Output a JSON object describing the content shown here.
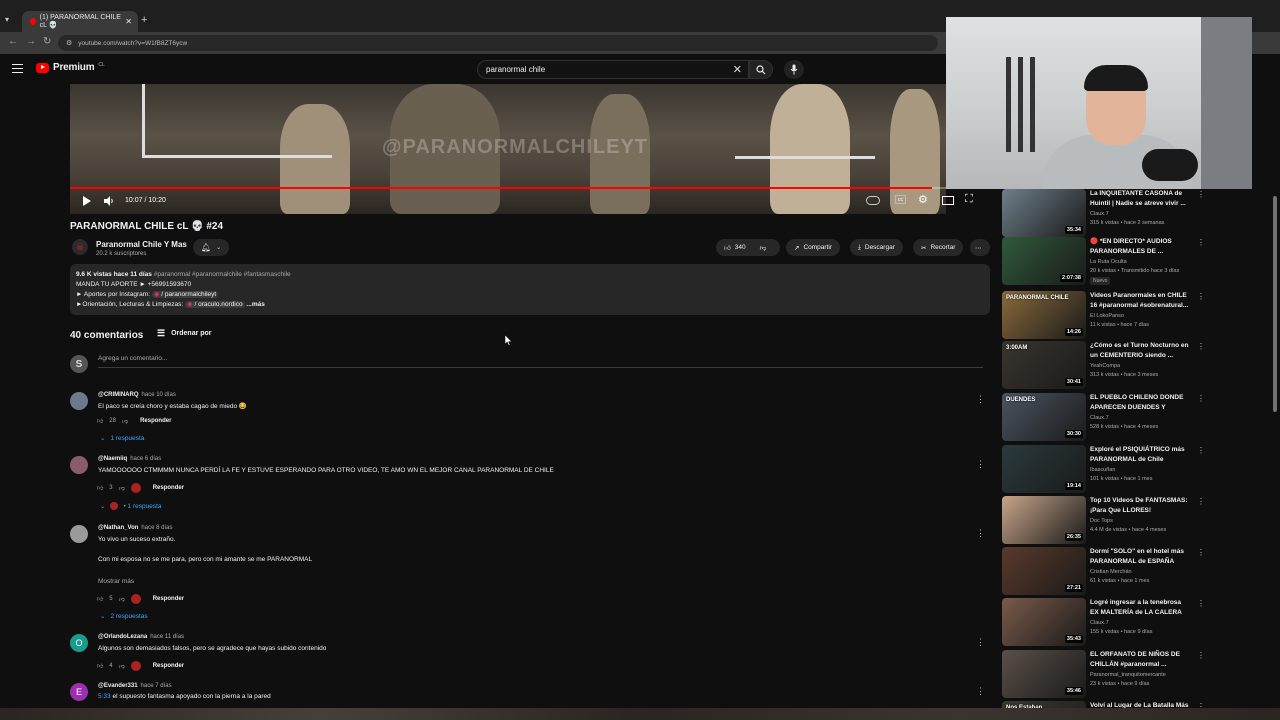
{
  "browser": {
    "tab_title": "(1) PARANORMAL CHILE cL 💀",
    "url": "youtube.com/watch?v=W1fB8ZT6ycw"
  },
  "header": {
    "logo_text": "Premium",
    "logo_region": "CL",
    "search_value": "paranormal chile"
  },
  "player": {
    "watermark": "@PARANORMALCHILEYT",
    "time": "10:07 / 10:20",
    "progress_fraction": 0.984
  },
  "video": {
    "title": "PARANORMAL CHILE cL 💀 #24",
    "channel": "Paranormal Chile Y Mas",
    "subscribers": "20.2 k suscriptores",
    "likes": "340",
    "share_label": "Compartir",
    "download_label": "Descargar",
    "clip_label": "Recortar"
  },
  "description": {
    "meta": "9.6 K vistas  hace 11 días",
    "tags": "#paranormal #paranormalchile #fantasmaschile",
    "line1": "MANDA TU APORTE ► +56991593670",
    "line2_prefix": "► Aportes por Instagram:",
    "line2_link": "/ paranormalchileyt",
    "line3_prefix": "►Orientación, Lecturas & Limpiezas:",
    "line3_link": "/ oraculo.nordico",
    "more": "...más"
  },
  "comments": {
    "count": "40 comentarios",
    "sort_label": "Ordenar por",
    "add_placeholder": "Agrega un comentario...",
    "my_avatar": "S",
    "reply_label": "Responder",
    "items": [
      {
        "handle": "@CRIMINARQ",
        "ago": "hace 10 días",
        "text": "El paco se creía choro y estaba cagao de miedo 😂",
        "likes": "28",
        "replies": "1 respuesta",
        "color": "#6b7b8c",
        "initial": ""
      },
      {
        "handle": "@Naemiiq",
        "ago": "hace 6 días",
        "text": "YAMOOOOOO CTMMMM NUNCA PERDÍ LA FE Y ESTUVE ESPERANDO PARA OTRO VIDEO, TE AMO WN EL MEJOR CANAL PARANORMAL DE CHILE",
        "likes": "3",
        "replies": "• 1 respuesta",
        "color": "#8a5c6a",
        "initial": ""
      },
      {
        "handle": "@Nathan_Von",
        "ago": "hace 8 días",
        "text": "Yo vivo un suceso extraño.",
        "text2": "Con mi esposa no se me para, pero con mi amante se me PARANORMAL",
        "show_more": "Mostrar más",
        "likes": "5",
        "replies": "2 respuestas",
        "color": "#9a9a9a",
        "initial": ""
      },
      {
        "handle": "@OrlandoLezana",
        "ago": "hace 11 días",
        "text": "Algunos son demasiados falsos, pero se agradece que hayas subido contenido",
        "likes": "4",
        "color": "#1a9c8c",
        "initial": "O"
      },
      {
        "handle": "@Evander331",
        "ago": "hace 7 días",
        "timestamp": "5:33",
        "text": "el supuesto fantasma apoyado con la pierna a la pared",
        "color": "#9c2fb0",
        "initial": "E"
      }
    ]
  },
  "related": [
    {
      "title": "La INQUIETANTE CASONA de Huintil | Nadie se atreve vivir ...",
      "channel": "Claux.7",
      "meta": "315 k vistas • hace 2 semanas",
      "duration": "35:34",
      "thumb": "#6e7f8a"
    },
    {
      "title": "🔴 *EN DIRECTO* AUDIOS PARANORMALES DE ...",
      "channel": "La Ruta Oculta",
      "meta": "20 k vistas • Transmitido hace 3 días",
      "badge": "Nuevo",
      "duration": "2:07:38",
      "thumb": "#2f5a3a"
    },
    {
      "title": "Videos Paranormales en CHILE 16 #paranormal #sobrenatural...",
      "channel": "El LokoPanso",
      "meta": "11 k vistas • hace 7 días",
      "duration": "14:26",
      "thumb": "#8a6a3a",
      "thumb_text": "PARANORMAL CHILE"
    },
    {
      "title": "¿Cómo es el Turno Nocturno en un CEMENTERIO siendo ...",
      "channel": "YeahCompa",
      "meta": "313 k vistas • hace 3 meses",
      "duration": "30:41",
      "thumb": "#3a352e",
      "thumb_text": "3:00AM"
    },
    {
      "title": "EL PUEBLO CHILENO DONDE APARECEN DUENDES Y HADAS",
      "channel": "Claux.7",
      "meta": "528 k vistas • hace 4 meses",
      "duration": "30:30",
      "thumb": "#4a5560",
      "thumb_text": "DUENDES"
    },
    {
      "title": "Exploré el PSIQUIÁTRICO más PARANORMAL de Chile",
      "channel": "Ibascuñan",
      "meta": "101 k vistas • hace 1 mes",
      "duration": "19:14",
      "thumb": "#2a3a3e"
    },
    {
      "title": "Top 10 Videos De FANTASMAS: ¡Para Que LLORES!",
      "channel": "Doc Tops",
      "meta": "4.4 M de vistas • hace 4 meses",
      "duration": "26:35",
      "thumb": "#c9a58a"
    },
    {
      "title": "Dormí \"SOLO\" en el hotel más PARANORMAL de ESPAÑA",
      "channel": "Cristian Merchán",
      "meta": "61 k vistas • hace 1 mes",
      "duration": "27:21",
      "thumb": "#5a3a2a"
    },
    {
      "title": "Logré ingresar a la tenebrosa EX MALTERÍA de LA CALERA",
      "channel": "Claux.7",
      "meta": "155 k vistas • hace 9 días",
      "duration": "35:43",
      "thumb": "#7a5a4a"
    },
    {
      "title": "EL ORFANATO DE NIÑOS DE CHILLÁN #paranormal ...",
      "channel": "Paranormal_tranquitomercante",
      "meta": "23 k vistas • hace 9 días",
      "duration": "35:46",
      "thumb": "#5a5048"
    },
    {
      "title": "Volví al Lugar de La Batalla Más",
      "channel": "",
      "meta": "",
      "duration": "",
      "thumb": "#3a3a30",
      "thumb_text": "Nos Estaban"
    }
  ],
  "colors": {
    "accent_red": "#ff0000",
    "link_blue": "#3ea6ff",
    "bg": "#0f0f0f"
  }
}
